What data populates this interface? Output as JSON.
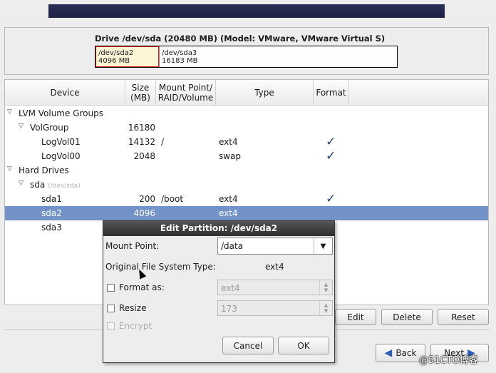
{
  "drive": {
    "title": "Drive /dev/sda (20480 MB) (Model: VMware, VMware Virtual S)",
    "segments": [
      {
        "name": "/dev/sda2",
        "size": "4096 MB"
      },
      {
        "name": "/dev/sda3",
        "size": "16183 MB"
      }
    ]
  },
  "table": {
    "headers": {
      "device": "Device",
      "size": "Size\n(MB)",
      "mount": "Mount Point/\nRAID/Volume",
      "type": "Type",
      "format": "Format"
    },
    "rows": [
      {
        "device": "LVM Volume Groups",
        "size": "",
        "mount": "",
        "type": "",
        "format": ""
      },
      {
        "device": "VolGroup",
        "size": "16180",
        "mount": "",
        "type": "",
        "format": ""
      },
      {
        "device": "LogVol01",
        "size": "14132",
        "mount": "/",
        "type": "ext4",
        "format": "✓"
      },
      {
        "device": "LogVol00",
        "size": "2048",
        "mount": "",
        "type": "swap",
        "format": "✓"
      },
      {
        "device": "Hard Drives",
        "size": "",
        "mount": "",
        "type": "",
        "format": ""
      },
      {
        "device": "sda",
        "subpath": "(/dev/sda)",
        "size": "",
        "mount": "",
        "type": "",
        "format": ""
      },
      {
        "device": "sda1",
        "size": "200",
        "mount": "/boot",
        "type": "ext4",
        "format": "✓"
      },
      {
        "device": "sda2",
        "size": "4096",
        "mount": "",
        "type": "ext4",
        "format": ""
      },
      {
        "device": "sda3",
        "size": "",
        "mount": "",
        "type": "",
        "format": ""
      }
    ],
    "expander_icon": "triangle-down-icon"
  },
  "actions": {
    "edit": "Edit",
    "delete": "Delete",
    "reset": "Reset"
  },
  "nav": {
    "back": "Back",
    "next": "Next",
    "back_icon": "arrow-left-icon",
    "next_icon": "arrow-right-icon"
  },
  "dialog": {
    "title": "Edit Partition: /dev/sda2",
    "mount_label": "Mount Point:",
    "mount_value": "/data",
    "ofs_label": "Original File System Type:",
    "ofs_value": "ext4",
    "format_label": "Format as:",
    "format_value": "ext4",
    "resize_label": "Resize",
    "resize_value": "173",
    "encrypt_label": "Encrypt",
    "cancel": "Cancel",
    "ok": "OK"
  },
  "watermark": "@51CTO博客"
}
